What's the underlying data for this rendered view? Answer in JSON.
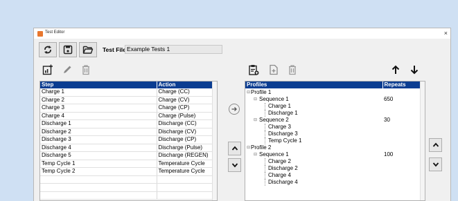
{
  "window": {
    "title": "Test Editor",
    "close": "×"
  },
  "toolbar": {
    "test_file_label": "Test File",
    "test_file_value": "Example Tests 1"
  },
  "steps_table": {
    "headers": [
      "Step",
      "Action"
    ],
    "rows": [
      [
        "Charge 1",
        "Charge (CC)"
      ],
      [
        "Charge 2",
        "Charge (CV)"
      ],
      [
        "Charge 3",
        "Charge (CP)"
      ],
      [
        "Charge 4",
        "Charge (Pulse)"
      ],
      [
        "Discharge 1",
        "Discharge (CC)"
      ],
      [
        "Discharge 2",
        "Discharge (CV)"
      ],
      [
        "Discharge 3",
        "Discharge (CP)"
      ],
      [
        "Discharge 4",
        "Discharge (Pulse)"
      ],
      [
        "Discharge 5",
        "Discharge (REGEN)"
      ],
      [
        "Temp Cycle 1",
        "Temperature Cycle"
      ],
      [
        "Temp Cycle 2",
        "Temperature Cycle"
      ],
      [
        "",
        ""
      ],
      [
        "",
        ""
      ],
      [
        "",
        ""
      ]
    ]
  },
  "profiles_tree": {
    "headers": [
      "Profiles",
      "Repeats"
    ],
    "rows": [
      {
        "label": "Profile 1",
        "level": 0,
        "repeats": ""
      },
      {
        "label": "Sequence 1",
        "level": 1,
        "repeats": "650"
      },
      {
        "label": "Charge 1",
        "level": 2,
        "repeats": ""
      },
      {
        "label": "Discharge 1",
        "level": 2,
        "repeats": ""
      },
      {
        "label": "Sequence 2",
        "level": 1,
        "repeats": "30"
      },
      {
        "label": "Charge 3",
        "level": 2,
        "repeats": ""
      },
      {
        "label": "Discharge 3",
        "level": 2,
        "repeats": ""
      },
      {
        "label": "Temp Cycle 1",
        "level": 2,
        "repeats": ""
      },
      {
        "label": "Profile 2",
        "level": 0,
        "repeats": ""
      },
      {
        "label": "Sequence 1",
        "level": 1,
        "repeats": "100"
      },
      {
        "label": "Charge 2",
        "level": 2,
        "repeats": ""
      },
      {
        "label": "Discharge 2",
        "level": 2,
        "repeats": ""
      },
      {
        "label": "Charge 4",
        "level": 2,
        "repeats": ""
      },
      {
        "label": "Discharge 4",
        "level": 2,
        "repeats": ""
      }
    ]
  },
  "icons": {
    "refresh": "refresh-icon",
    "save": "save-icon",
    "open_folder": "folder-open-icon",
    "add_step": "add-chart-icon",
    "edit": "pencil-icon",
    "delete": "trash-icon",
    "add_to_profile": "arrow-right-circle-icon",
    "paste": "clipboard-add-icon",
    "new_doc": "document-add-icon",
    "move_up": "arrow-up-icon",
    "move_down": "arrow-down-icon",
    "chevron_up": "chevron-up-icon",
    "chevron_down": "chevron-down-icon"
  },
  "colors": {
    "header_bg": "#0b3d91",
    "header_text": "#ffffff",
    "window_bg": "#f0f0f0",
    "desktop": "#cfe0f3"
  }
}
